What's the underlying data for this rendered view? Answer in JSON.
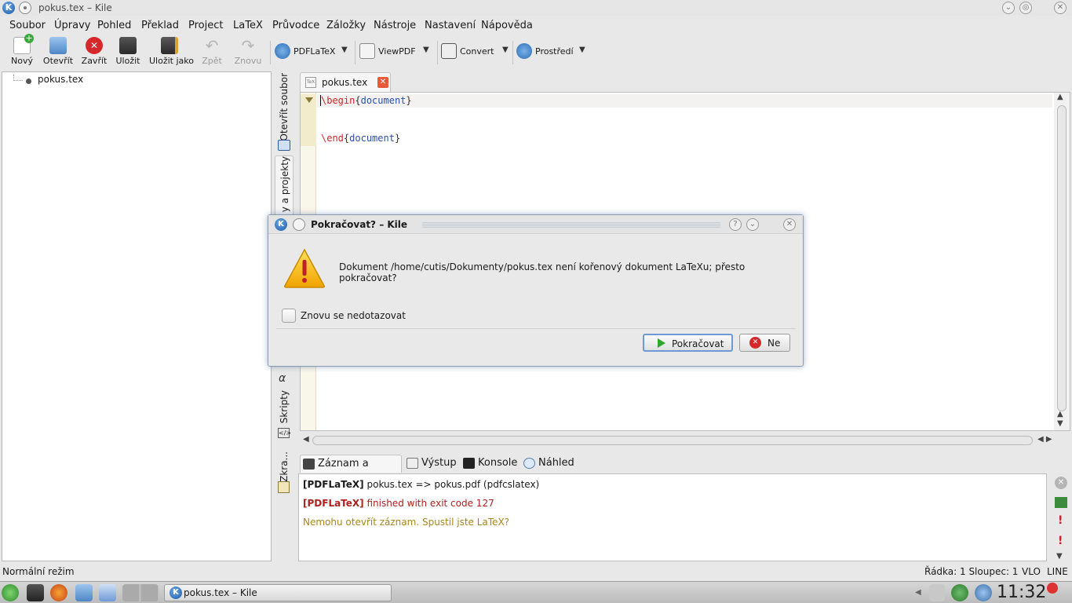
{
  "window": {
    "title": "pokus.tex – Kile"
  },
  "menubar": [
    "Soubor",
    "Úpravy",
    "Pohled",
    "Překlad",
    "Project",
    "LaTeX",
    "Průvodce",
    "Záložky",
    "Nástroje",
    "Nastavení",
    "Nápověda"
  ],
  "toolbar": {
    "new": "Nový",
    "open": "Otevřít",
    "close": "Zavřít",
    "save": "Uložit",
    "save_as": "Uložit jako",
    "undo": "Zpět",
    "redo": "Znovu",
    "build": "PDFLaTeX",
    "view": "ViewPDF",
    "convert": "Convert",
    "environment": "Prostředí"
  },
  "filetree": {
    "items": [
      "pokus.tex"
    ]
  },
  "sidebar": {
    "tabs": [
      "Otevřít soubor",
      "y a projekty",
      "Skripty",
      "Zkra..."
    ]
  },
  "editor": {
    "tab_label": "pokus.tex",
    "lines": [
      {
        "cmd": "\\begin",
        "env": "document"
      },
      {
        "cmd": "",
        "env": ""
      },
      {
        "cmd": "\\end",
        "env": "document"
      }
    ]
  },
  "bottom_panel": {
    "tabs": [
      "Záznam a zprávy",
      "Výstup",
      "Konsole",
      "Náhled"
    ],
    "log": [
      {
        "tag": "[PDFLaTeX]",
        "text": "pokus.tex => pokus.pdf (pdfcslatex)",
        "color": "#1a1a1a"
      },
      {
        "tag": "[PDFLaTeX]",
        "text": "finished with exit code 127",
        "color": "#b0201e"
      },
      {
        "tag": "",
        "text": "Nemohu otevřít záznam. Spustil jste LaTeX?",
        "color": "#a8861a"
      }
    ]
  },
  "statusbar": {
    "mode": "Normální režim",
    "position": "Řádka: 1 Sloupec: 1",
    "insert_mode": "VLO",
    "select_mode": "LINE"
  },
  "taskbar": {
    "window_button": "pokus.tex – Kile",
    "clock": "11:32"
  },
  "dialog": {
    "title": "Pokračovat? – Kile",
    "message": "Dokument /home/cutis/Dokumenty/pokus.tex není kořenový dokument LaTeXu; přesto pokračovat?",
    "dont_ask_label": "Znovu se nedotazovat",
    "continue_label": "Pokračovat",
    "no_label": "Ne"
  },
  "colors": {
    "accent": "#6e99d6",
    "error": "#b0201e",
    "warning": "#a8861a",
    "keyword": "#c9262a",
    "env": "#2a50b0"
  }
}
